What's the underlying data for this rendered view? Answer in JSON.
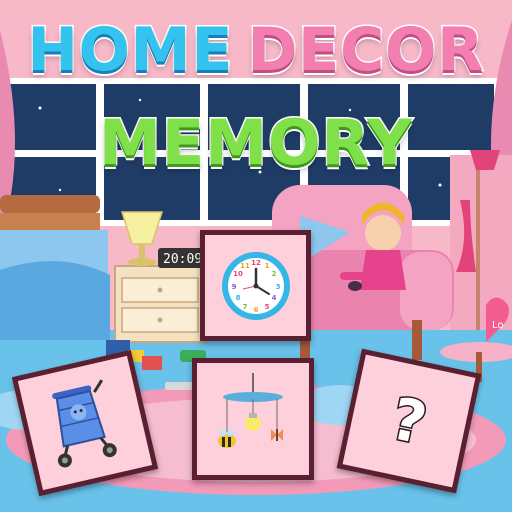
{
  "title": {
    "word1": "HOME",
    "word2": "DECOR",
    "word3": "MEMORY"
  },
  "scene": {
    "digital_clock_time": "20:09",
    "sign_text": "Lo"
  },
  "cards": [
    {
      "name": "clock-card",
      "icon": "wall-clock-icon",
      "state": "face-up"
    },
    {
      "name": "stroller-card",
      "icon": "stroller-icon",
      "state": "face-up"
    },
    {
      "name": "mobile-card",
      "icon": "baby-mobile-icon",
      "state": "face-up"
    },
    {
      "name": "unknown-card",
      "icon": "question-mark-icon",
      "state": "face-down",
      "label": "?"
    }
  ],
  "colors": {
    "home": "#33c3ee",
    "decor": "#f37fb1",
    "memory": "#7fe04a",
    "card_border": "#5a1f31",
    "card_face": "#fdd0dc"
  }
}
